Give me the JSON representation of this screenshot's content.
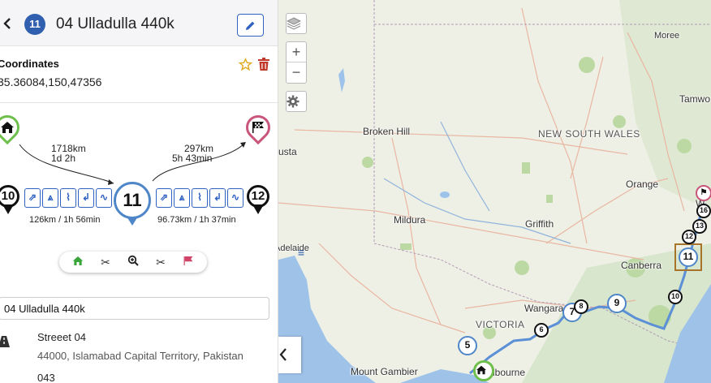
{
  "header": {
    "back_icon": "chevron-left-icon",
    "stop_number": "11",
    "title": "04 Ulladulla 440k",
    "edit_icon": "pencil-icon",
    "accent": "#2f5fae"
  },
  "coordinates": {
    "label": "Coordinates",
    "value": "35.36084,150,47356",
    "favorite_icon": "star-outline-icon",
    "delete_icon": "trash-icon",
    "delete_color": "#c0392b",
    "star_color": "#e0a81c"
  },
  "route": {
    "start_icon": "home-icon",
    "end_icon": "checkered-flag-icon",
    "to_current": {
      "distance": "1718km",
      "duration": "1d 2h"
    },
    "to_end": {
      "distance": "297km",
      "duration": "5h 43min"
    },
    "prev_stop": "10",
    "current_stop": "11",
    "next_stop": "12",
    "prev_leg": "126km / 1h 56min",
    "next_leg": "96.73km / 1h 37min",
    "mode_icons": [
      "ferry-icon",
      "highway-icon",
      "path-icon",
      "curve-icon",
      "winding-road-icon"
    ]
  },
  "toolbar": {
    "items": [
      {
        "icon": "home-icon",
        "color": "#3aa53a"
      },
      {
        "icon": "scissors-icon",
        "color": "#333333"
      },
      {
        "icon": "zoom-in-icon",
        "color": "#333333"
      },
      {
        "icon": "scissors-icon",
        "color": "#333333"
      },
      {
        "icon": "flag-icon",
        "color": "#d04468"
      }
    ]
  },
  "form": {
    "name_value": "04 Ulladulla 440k"
  },
  "address": {
    "icon": "road-icon",
    "street": "Streeet 04",
    "locality": "44000, Islamabad Capital Territory, Pakistan",
    "extra": "043"
  },
  "map": {
    "labels": {
      "broken_hill": "Broken Hill",
      "nsw": "NEW SOUTH WALES",
      "moree": "Moree",
      "tamworth": "Tamwo",
      "orange": "Orange",
      "mildura": "Mildura",
      "griffith": "Griffith",
      "canberra": "Canberra",
      "adelaide": "Adelaide",
      "wangaratta": "Wangara",
      "victoria": "VICTORIA",
      "mount_gambier": "Mount Gambier",
      "melbourne": "lbourne",
      "usta": "usta",
      "w": "W"
    },
    "markers": [
      "5",
      "6",
      "7",
      "8",
      "9",
      "10",
      "11",
      "12",
      "13",
      "16"
    ],
    "route_color": "#5b8fd6",
    "zoom_in": "+",
    "zoom_out": "−",
    "layers_icon": "layers-icon",
    "settings_icon": "gear-icon",
    "collapse_icon": "chevron-left-icon"
  }
}
